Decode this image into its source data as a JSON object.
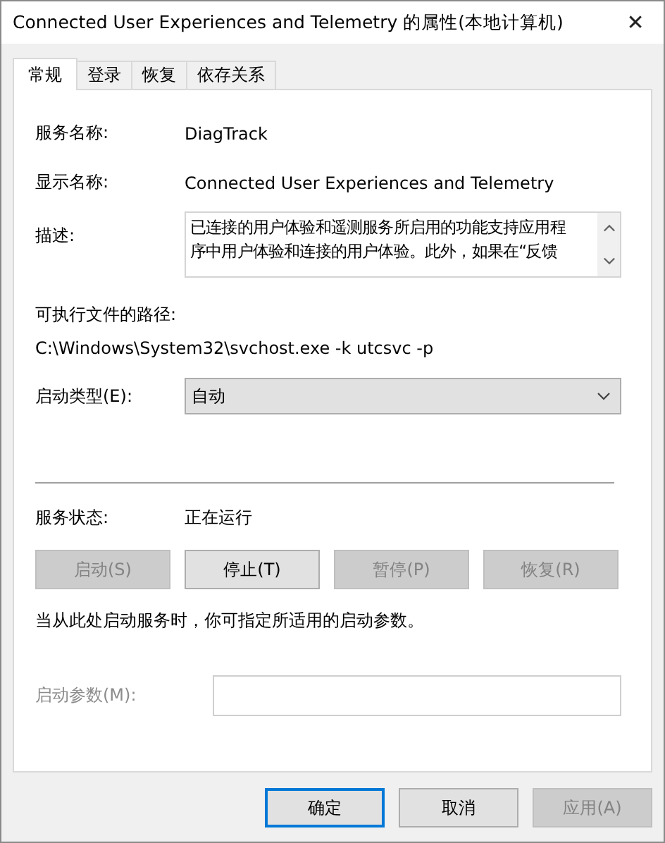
{
  "window": {
    "title": "Connected User Experiences and Telemetry 的属性(本地计算机)",
    "close": "✕"
  },
  "tabs": [
    {
      "label": "常规",
      "selected": true
    },
    {
      "label": "登录",
      "selected": false
    },
    {
      "label": "恢复",
      "selected": false
    },
    {
      "label": "依存关系",
      "selected": false
    }
  ],
  "service_name": {
    "label": "服务名称:",
    "value": "DiagTrack"
  },
  "display_name": {
    "label": "显示名称:",
    "value": "Connected User Experiences and Telemetry"
  },
  "description": {
    "label": "描述:",
    "lines": [
      "已连接的用户体验和遥测服务所启用的功能支持应用程",
      "序中用户体验和连接的用户体验。此外，如果在“反馈"
    ]
  },
  "executable_path": {
    "label": "可执行文件的路径:",
    "value": "C:\\Windows\\System32\\svchost.exe -k utcsvc -p"
  },
  "startup_type": {
    "label": "启动类型(E):",
    "value": "自动"
  },
  "service_status": {
    "label": "服务状态:",
    "value": "正在运行"
  },
  "service_buttons": [
    {
      "label": "启动(S)",
      "disabled": true
    },
    {
      "label": "停止(T)",
      "disabled": false
    },
    {
      "label": "暂停(P)",
      "disabled": true
    },
    {
      "label": "恢复(R)",
      "disabled": true
    }
  ],
  "hint": "当从此处启动服务时，你可指定所适用的启动参数。",
  "start_parameters": {
    "label": "启动参数(M):",
    "disabled": true
  },
  "dialog_buttons": [
    {
      "label": "确定",
      "default": true,
      "disabled": false
    },
    {
      "label": "取消",
      "default": false,
      "disabled": false
    },
    {
      "label": "应用(A)",
      "default": false,
      "disabled": true
    }
  ]
}
